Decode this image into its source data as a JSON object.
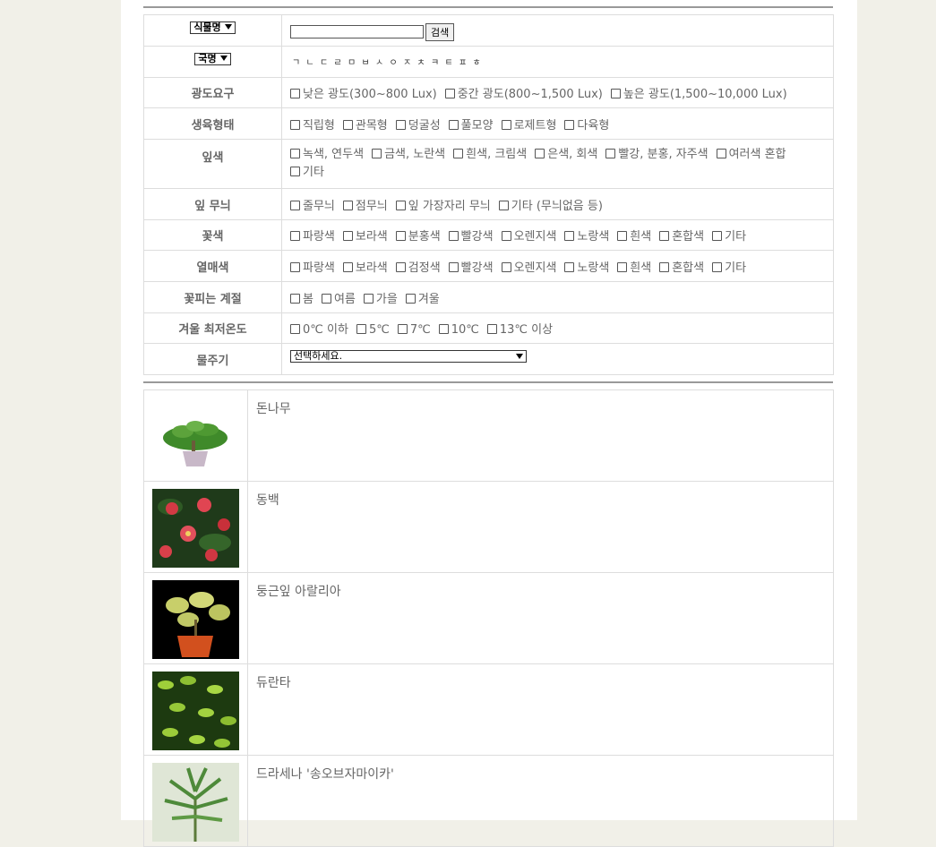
{
  "search": {
    "name_select": "식물명",
    "search_button": "검색",
    "input_value": ""
  },
  "index": {
    "country_select": "국명",
    "consonants": [
      "ㄱ",
      "ㄴ",
      "ㄷ",
      "ㄹ",
      "ㅁ",
      "ㅂ",
      "ㅅ",
      "ㅇ",
      "ㅈ",
      "ㅊ",
      "ㅋ",
      "ㅌ",
      "ㅍ",
      "ㅎ"
    ]
  },
  "filters": [
    {
      "label": "광도요구",
      "options": [
        "낮은 광도(300~800 Lux)",
        "중간 광도(800~1,500 Lux)",
        "높은 광도(1,500~10,000 Lux)"
      ]
    },
    {
      "label": "생육형태",
      "options": [
        "직립형",
        "관목형",
        "덩굴성",
        "풀모양",
        "로제트형",
        "다육형"
      ]
    },
    {
      "label": "잎색",
      "options": [
        "녹색, 연두색",
        "금색, 노란색",
        "흰색, 크림색",
        "은색, 회색",
        "빨강, 분홍, 자주색",
        "여러색 혼합",
        "기타"
      ]
    },
    {
      "label": "잎 무늬",
      "options": [
        "줄무늬",
        "점무늬",
        "잎 가장자리 무늬",
        "기타 (무늬없음 등)"
      ]
    },
    {
      "label": "꽃색",
      "options": [
        "파랑색",
        "보라색",
        "분홍색",
        "빨강색",
        "오렌지색",
        "노랑색",
        "흰색",
        "혼합색",
        "기타"
      ]
    },
    {
      "label": "열매색",
      "options": [
        "파랑색",
        "보라색",
        "검정색",
        "빨강색",
        "오렌지색",
        "노랑색",
        "흰색",
        "혼합색",
        "기타"
      ]
    },
    {
      "label": "꽃피는 계절",
      "options": [
        "봄",
        "여름",
        "가을",
        "겨울"
      ]
    },
    {
      "label": "겨울 최저온도",
      "options": [
        "0℃ 이하",
        "5℃",
        "7℃",
        "10℃",
        "13℃ 이상"
      ]
    }
  ],
  "watering": {
    "label": "물주기",
    "selected": "선택하세요."
  },
  "plants": [
    {
      "name": "돈나무",
      "image": "potted-plant"
    },
    {
      "name": "동백",
      "image": "camellia"
    },
    {
      "name": "둥근잎 아랄리아",
      "image": "round-leaf-aralia"
    },
    {
      "name": "듀란타",
      "image": "duranta"
    },
    {
      "name": "드라세나 '송오브자마이카'",
      "image": "dracaena"
    }
  ]
}
